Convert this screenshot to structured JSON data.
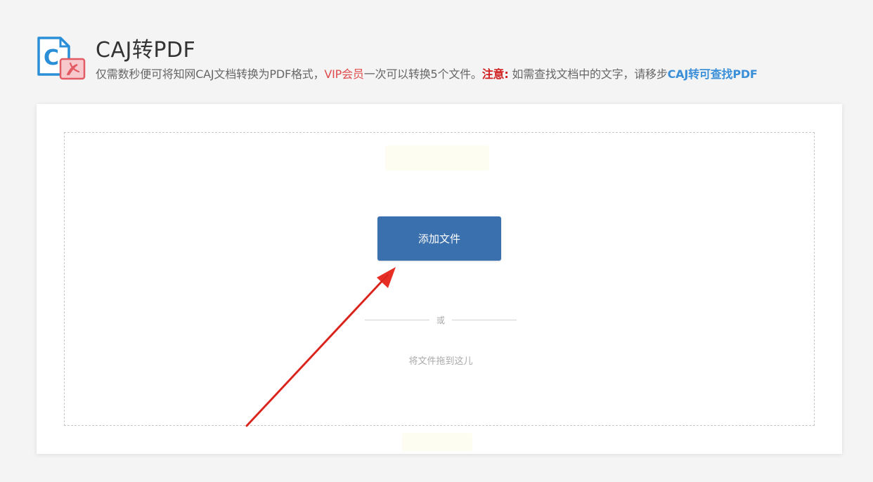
{
  "header": {
    "title": "CAJ转PDF",
    "subtitle_part1": "仅需数秒便可将知网CAJ文档转换为PDF格式，",
    "vip_text": "VIP会员",
    "subtitle_part2": "一次可以转换5个文件。",
    "note_label": "注意:",
    "subtitle_part3": " 如需查找文档中的文字，请移步",
    "link_text": "CAJ转可查找PDF"
  },
  "logo": {
    "letter": "C",
    "icon": "caj-to-pdf-logo-icon",
    "colors": {
      "caj": "#2a8fd6",
      "pdf": "#e25a63"
    }
  },
  "upload": {
    "add_button_label": "添加文件",
    "or_text": "或",
    "drag_hint": "将文件拖到这儿",
    "button_color": "#3a70ad"
  },
  "annotation": {
    "arrow_color": "#e62e25",
    "icon": "red-arrow-icon"
  }
}
